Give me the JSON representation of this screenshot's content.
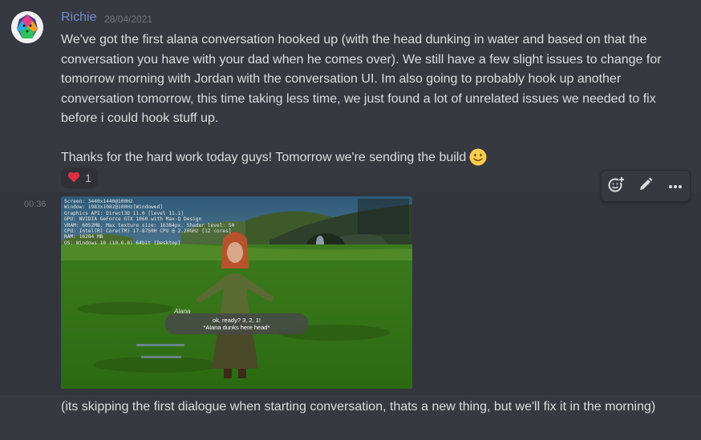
{
  "message1": {
    "author": "Richie",
    "timestamp": "28/04/2021",
    "author_color": "#7289da",
    "paragraph1": "We've got the first alana conversation hooked up (with the head dunking in water and based on that the conversation you have with your dad when he comes over). We still have a few slight issues to change for tomorrow morning with Jordan with the conversation UI. Im also going to probably hook up another conversation tomorrow, this time taking less time, we just found a lot of unrelated issues we needed to fix before i could hook stuff up.",
    "paragraph2": "Thanks for the hard work today guys! Tomorrow we're sending the build",
    "emoji": "slightly-smiling-face-icon",
    "reaction": {
      "icon": "heart-icon",
      "count": "1"
    }
  },
  "message2": {
    "time": "00:36",
    "caption": "(its skipping the first dialogue when starting conversation, thats a new thing, but we'll fix it in the morning)",
    "screenshot": {
      "hud_lines": [
        "Screen: 3440x1440@100Hz",
        "Window: 1983x1082@100Hz[Windowed]",
        "Graphics API: Direct3D 11.0 [level 11.1]",
        "GPU: NVIDIA GeForce GTX 1060 with Max-Q Design",
        "VRAM: 6052MB. Max texture size: 16384px. Shader level: 50",
        "CPU: Intel(R) Core(TM) i7-8750H CPU @ 2.20GHz [12 cores]",
        "RAM: 16284 MB",
        "OS: Windows 10  (10.0.0) 64bit [Desktop]"
      ],
      "speaker": "Alana",
      "dialog_line1": "ok, ready? 3, 2, 1!",
      "dialog_line2": "*Alana dunks here head*"
    }
  },
  "toolbar": {
    "add_reaction": "add-reaction-icon",
    "edit": "pencil-icon",
    "more": "more-icon"
  }
}
